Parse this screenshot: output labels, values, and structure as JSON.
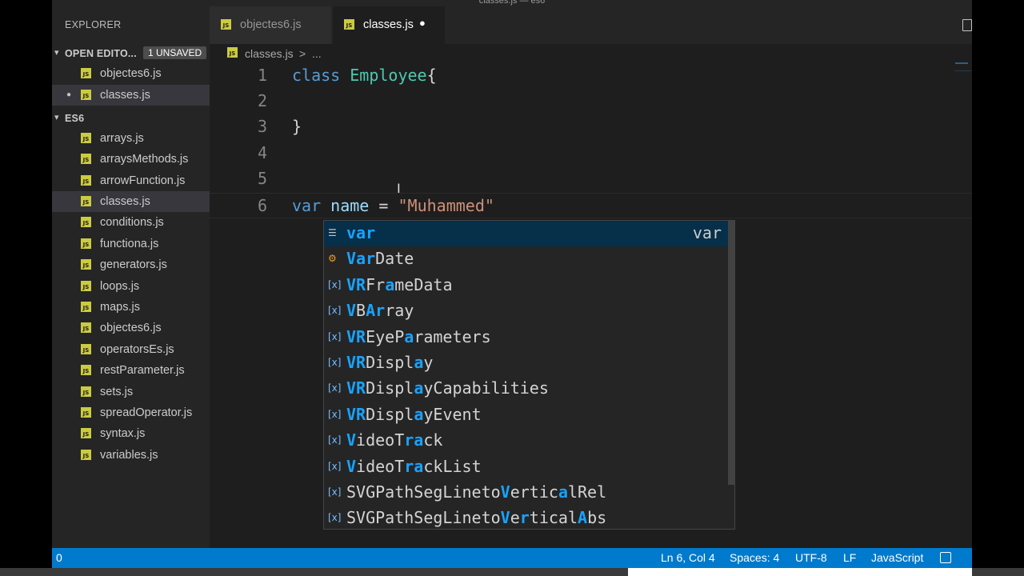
{
  "window": {
    "title": "classes.js — es6"
  },
  "sidebar": {
    "title": "EXPLORER",
    "open_editors": {
      "label": "OPEN EDITO...",
      "badge": "1 UNSAVED",
      "files": [
        {
          "name": "objectes6.js",
          "dirty": false
        },
        {
          "name": "classes.js",
          "dirty": true
        }
      ]
    },
    "folder": {
      "label": "ES6",
      "files": [
        "arrays.js",
        "arraysMethods.js",
        "arrowFunction.js",
        "classes.js",
        "conditions.js",
        "functiona.js",
        "generators.js",
        "loops.js",
        "maps.js",
        "objectes6.js",
        "operatorsEs.js",
        "restParameter.js",
        "sets.js",
        "spreadOperator.js",
        "syntax.js",
        "variables.js"
      ]
    }
  },
  "tabs": [
    {
      "label": "objectes6.js",
      "active": false
    },
    {
      "label": "classes.js",
      "active": true
    }
  ],
  "breadcrumb": {
    "file": "classes.js",
    "separator": ">",
    "more": "..."
  },
  "editor": {
    "line_numbers": [
      "1",
      "2",
      "3",
      "4",
      "5",
      "6"
    ],
    "code": {
      "l1_kw": "class",
      "l1_cls": "Employee",
      "l1_brace": "{",
      "l3": "}",
      "l6_kw": "var",
      "l6_name": "name",
      "l6_eq": "=",
      "l6_str": "\"Muhammed\""
    }
  },
  "suggestions": {
    "selected_detail": "var",
    "items": [
      {
        "kind": "keyword",
        "label": "var"
      },
      {
        "kind": "class",
        "label": "VarDate"
      },
      {
        "kind": "variable",
        "label": "VRFrameData"
      },
      {
        "kind": "variable",
        "label": "VBArray"
      },
      {
        "kind": "variable",
        "label": "VREyeParameters"
      },
      {
        "kind": "variable",
        "label": "VRDisplay"
      },
      {
        "kind": "variable",
        "label": "VRDisplayCapabilities"
      },
      {
        "kind": "variable",
        "label": "VRDisplayEvent"
      },
      {
        "kind": "variable",
        "label": "VideoTrack"
      },
      {
        "kind": "variable",
        "label": "VideoTrackList"
      },
      {
        "kind": "variable",
        "label": "SVGPathSegLinetoVerticalRel"
      },
      {
        "kind": "variable",
        "label": "SVGPathSegLinetoVerticalAbs"
      }
    ]
  },
  "statusbar": {
    "problems": "0",
    "position": "Ln 6, Col 4",
    "indent": "Spaces: 4",
    "encoding": "UTF-8",
    "eol": "LF",
    "language": "JavaScript"
  },
  "colors": {
    "statusbar_bg": "#007acc",
    "keyword": "#569cd6",
    "class_name": "#4ec9b0",
    "variable": "#9cdcfe",
    "string": "#ce9178",
    "match_highlight": "#18a3ff"
  },
  "icons": [
    "js-file-icon",
    "chevron-down-icon",
    "split-editor-icon",
    "keyword-icon",
    "class-icon",
    "variable-icon",
    "feedback-icon",
    "text-cursor-icon"
  ]
}
